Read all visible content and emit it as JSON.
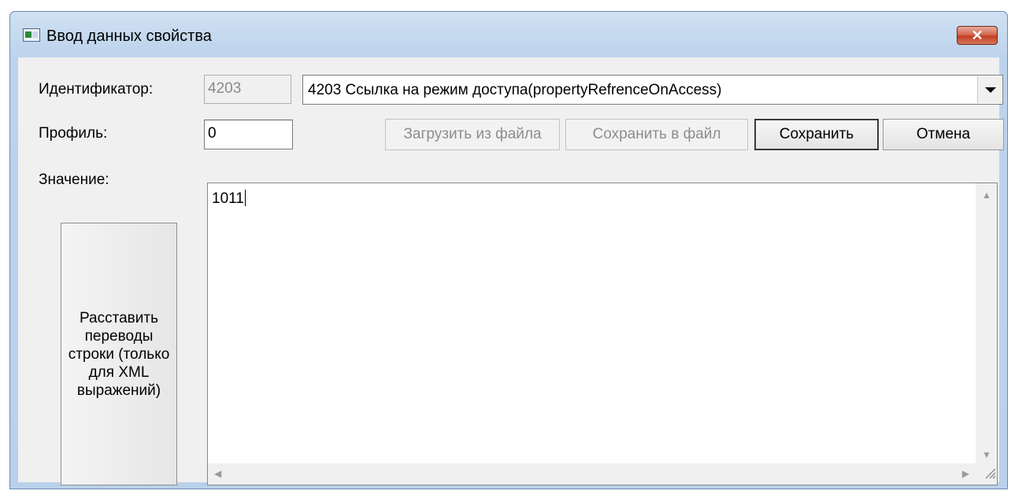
{
  "window": {
    "title": "Ввод данных свойства",
    "close_label": "✕"
  },
  "form": {
    "identifier_label": "Идентификатор:",
    "identifier_value": "4203",
    "identifier_combo": "4203 Ссылка на режим доступа(propertyRefrenceOnAccess)",
    "profile_label": "Профиль:",
    "profile_value": "0",
    "value_label": "Значение:",
    "value_text": "1011"
  },
  "buttons": {
    "load_from_file": "Загрузить из файла",
    "save_to_file": "Сохранить в файл",
    "save": "Сохранить",
    "cancel": "Отмена",
    "line_breaks": "Расставить переводы строки (только для XML выражений)"
  },
  "icons": {
    "app": "window-app-icon",
    "close": "close-icon",
    "dropdown": "chevron-down-icon",
    "scroll_up": "scroll-up-icon",
    "scroll_down": "scroll-down-icon",
    "scroll_left": "scroll-left-icon",
    "scroll_right": "scroll-right-icon",
    "resize": "resize-grip-icon"
  },
  "colors": {
    "titlebar": "#b9d1ea",
    "close_button": "#c8452a",
    "client_bg": "#f0f0f0"
  }
}
